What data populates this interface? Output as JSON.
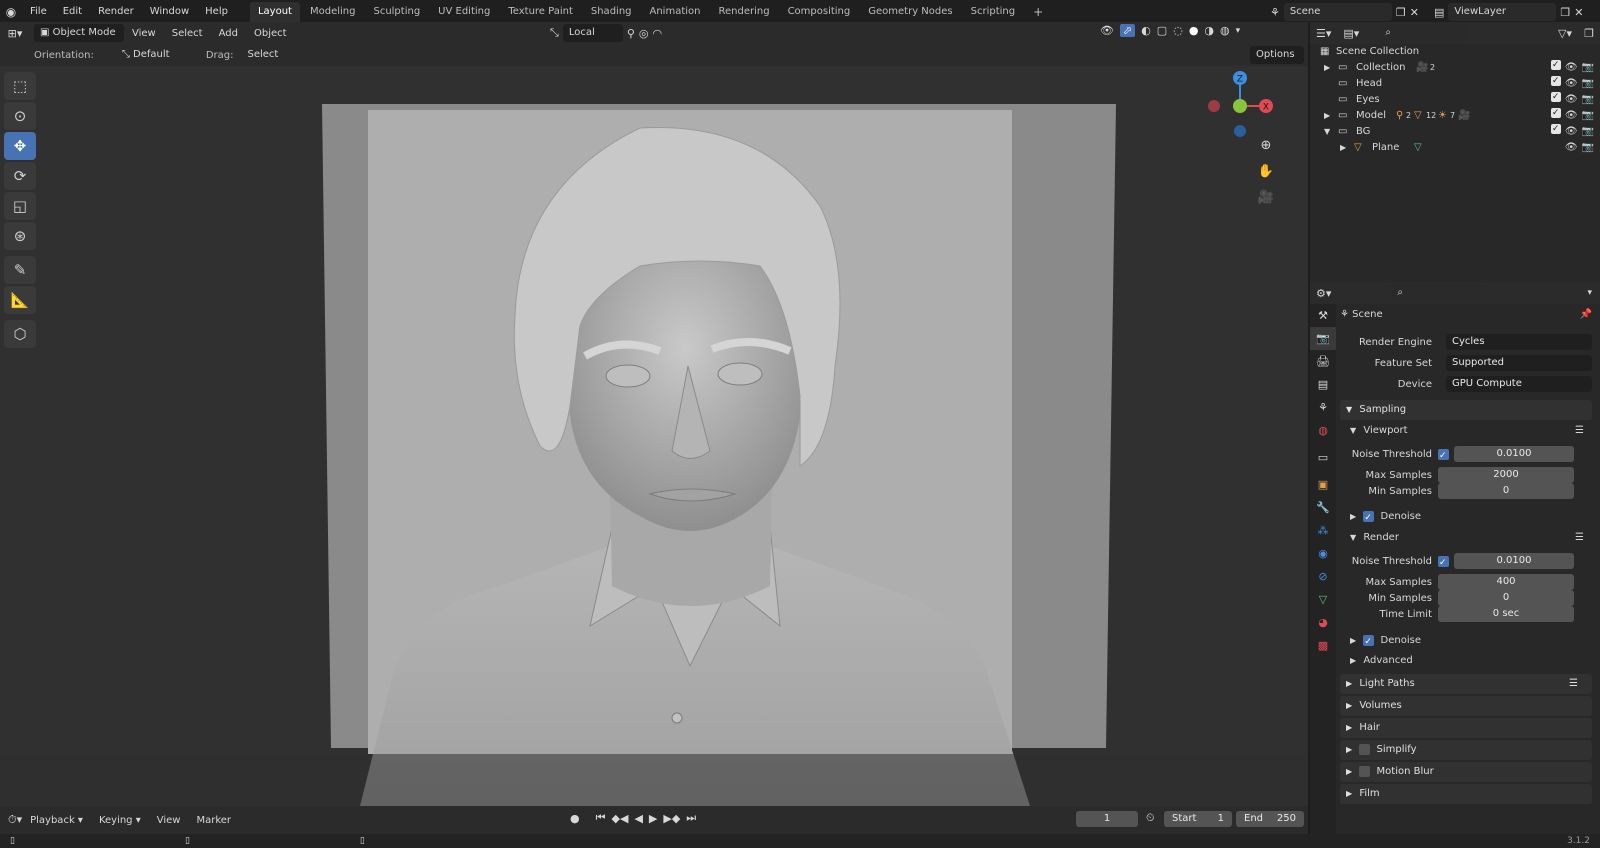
{
  "topbar": {
    "menus": [
      "File",
      "Edit",
      "Render",
      "Window",
      "Help"
    ],
    "workspaces": [
      "Layout",
      "Modeling",
      "Sculpting",
      "UV Editing",
      "Texture Paint",
      "Shading",
      "Animation",
      "Rendering",
      "Compositing",
      "Geometry Nodes",
      "Scripting"
    ],
    "active_workspace": "Layout",
    "scene": "Scene",
    "view_layer": "ViewLayer"
  },
  "viewport_header": {
    "mode": "Object Mode",
    "menus": [
      "View",
      "Select",
      "Add",
      "Object"
    ],
    "pivot": "Local",
    "orientation_label": "Orientation:",
    "orientation_value": "Default",
    "drag_label": "Drag:",
    "drag_value": "Select Box",
    "options": "Options"
  },
  "outliner": {
    "root": "Scene Collection",
    "items": [
      {
        "label": "Collection"
      },
      {
        "label": "Head"
      },
      {
        "label": "Eyes"
      },
      {
        "label": "Model"
      },
      {
        "label": "BG"
      },
      {
        "label": "Plane"
      }
    ],
    "badges": {
      "collection": "2",
      "model_a": "2",
      "model_b": "12",
      "model_c": "7"
    }
  },
  "properties": {
    "context": "Scene",
    "render_engine_label": "Render Engine",
    "render_engine": "Cycles",
    "feature_set_label": "Feature Set",
    "feature_set": "Supported",
    "device_label": "Device",
    "device": "GPU Compute",
    "sampling": "Sampling",
    "viewport": {
      "title": "Viewport",
      "noise_threshold_label": "Noise Threshold",
      "noise_threshold": "0.0100",
      "max_samples_label": "Max Samples",
      "max_samples": "2000",
      "min_samples_label": "Min Samples",
      "min_samples": "0",
      "denoise": "Denoise"
    },
    "render": {
      "title": "Render",
      "noise_threshold_label": "Noise Threshold",
      "noise_threshold": "0.0100",
      "max_samples_label": "Max Samples",
      "max_samples": "400",
      "min_samples_label": "Min Samples",
      "min_samples": "0",
      "time_limit_label": "Time Limit",
      "time_limit": "0 sec",
      "denoise": "Denoise"
    },
    "advanced": "Advanced",
    "panels": [
      "Light Paths",
      "Volumes",
      "Hair",
      "Simplify",
      "Motion Blur",
      "Film"
    ]
  },
  "timeline": {
    "menus": [
      "Playback",
      "Keying",
      "View",
      "Marker"
    ],
    "current_frame": "1",
    "start_label": "Start",
    "start": "1",
    "end_label": "End",
    "end": "250"
  },
  "status": {
    "version": "3.1.2"
  },
  "colors": {
    "accent": "#4772b3",
    "gizmo_x": "#e04a54",
    "gizmo_y": "#8ac43f",
    "gizmo_z": "#3b8fe0"
  }
}
